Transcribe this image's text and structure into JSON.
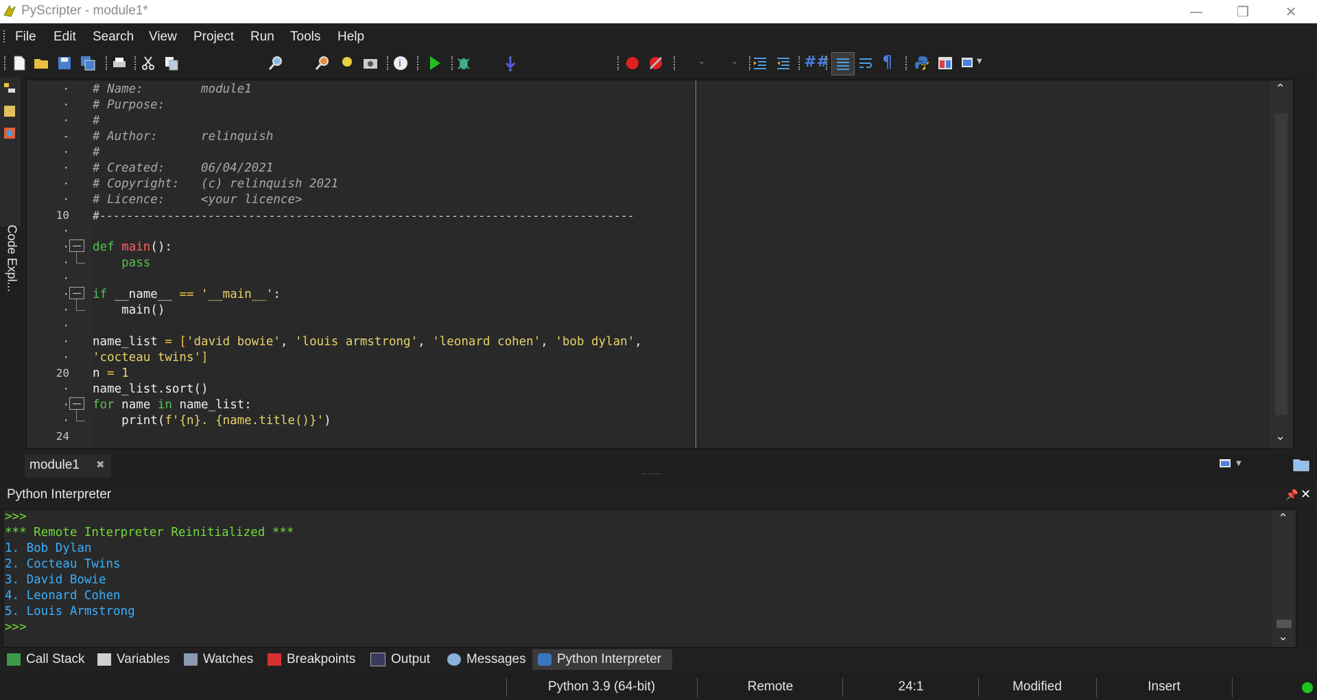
{
  "window": {
    "title": "PyScripter - module1*"
  },
  "menu": [
    "File",
    "Edit",
    "Search",
    "View",
    "Project",
    "Run",
    "Tools",
    "Help"
  ],
  "side_panel": {
    "label": "Code Expl..."
  },
  "editor": {
    "line_numbers": [
      {
        "n": "·",
        "row": 0
      },
      {
        "n": "·",
        "row": 1
      },
      {
        "n": "·",
        "row": 2
      },
      {
        "n": "-",
        "row": 3
      },
      {
        "n": "·",
        "row": 4
      },
      {
        "n": "·",
        "row": 5
      },
      {
        "n": "·",
        "row": 6
      },
      {
        "n": "·",
        "row": 7
      },
      {
        "n": "10",
        "row": 8
      },
      {
        "n": "·",
        "row": 9
      },
      {
        "n": "·",
        "row": 10
      },
      {
        "n": "·",
        "row": 11
      },
      {
        "n": "·",
        "row": 12
      },
      {
        "n": "·",
        "row": 13
      },
      {
        "n": "·",
        "row": 14
      },
      {
        "n": "·",
        "row": 15
      },
      {
        "n": "·",
        "row": 16
      },
      {
        "n": "·",
        "row": 17
      },
      {
        "n": "20",
        "row": 18
      },
      {
        "n": "·",
        "row": 19
      },
      {
        "n": "·",
        "row": 20
      },
      {
        "n": "·",
        "row": 21
      },
      {
        "n": "24",
        "row": 22
      }
    ],
    "lines": {
      "l1": "# Name:        module1",
      "l2": "# Purpose:",
      "l3": "#",
      "l4": "# Author:      relinquish",
      "l5": "#",
      "l6": "# Created:     06/04/2021",
      "l7": "# Copyright:   (c) relinquish 2021",
      "l8": "# Licence:     <your licence>",
      "l9": "#-------------------------------------------------------------------------------",
      "l11_kw": "def ",
      "l11_fn": "main",
      "l11_rest": "():",
      "l12": "    pass",
      "l14_kw": "if ",
      "l14_a": "__name__ ",
      "l14_op": "== ",
      "l14_str": "'__main__'",
      "l14_b": ":",
      "l15": "    main()",
      "l17_a": "name_list ",
      "l17_op": "= [",
      "l17_s1": "'david bowie'",
      "l17_c1": ", ",
      "l17_s2": "'louis armstrong'",
      "l17_c2": ", ",
      "l17_s3": "'leonard cohen'",
      "l17_c3": ", ",
      "l17_s4": "'bob dylan'",
      "l17_c4": ",",
      "l18_s": "'cocteau twins'",
      "l18_b": "]",
      "l19_a": "n ",
      "l19_op": "= ",
      "l19_b": "1",
      "l20": "name_list.sort()",
      "l21_kw": "for ",
      "l21_a": "name ",
      "l21_kw2": "in ",
      "l21_b": "name_list:",
      "l22_a": "    print(",
      "l22_s": "f'{n}. {name.title()}'",
      "l22_b": ")"
    }
  },
  "file_tab": {
    "label": "module1"
  },
  "interpreter": {
    "title": "Python Interpreter",
    "lines": [
      ">>>",
      "*** Remote Interpreter Reinitialized ***",
      "1. Bob Dylan",
      "2. Cocteau Twins",
      "3. David Bowie",
      "4. Leonard Cohen",
      "5. Louis Armstrong",
      ">>>"
    ]
  },
  "bottom_tabs": [
    "Call Stack",
    "Variables",
    "Watches",
    "Breakpoints",
    "Output",
    "Messages",
    "Python Interpreter"
  ],
  "status": {
    "python": "Python 3.9 (64-bit)",
    "engine": "Remote",
    "position": "24:1",
    "modified": "Modified",
    "mode": "Insert"
  }
}
